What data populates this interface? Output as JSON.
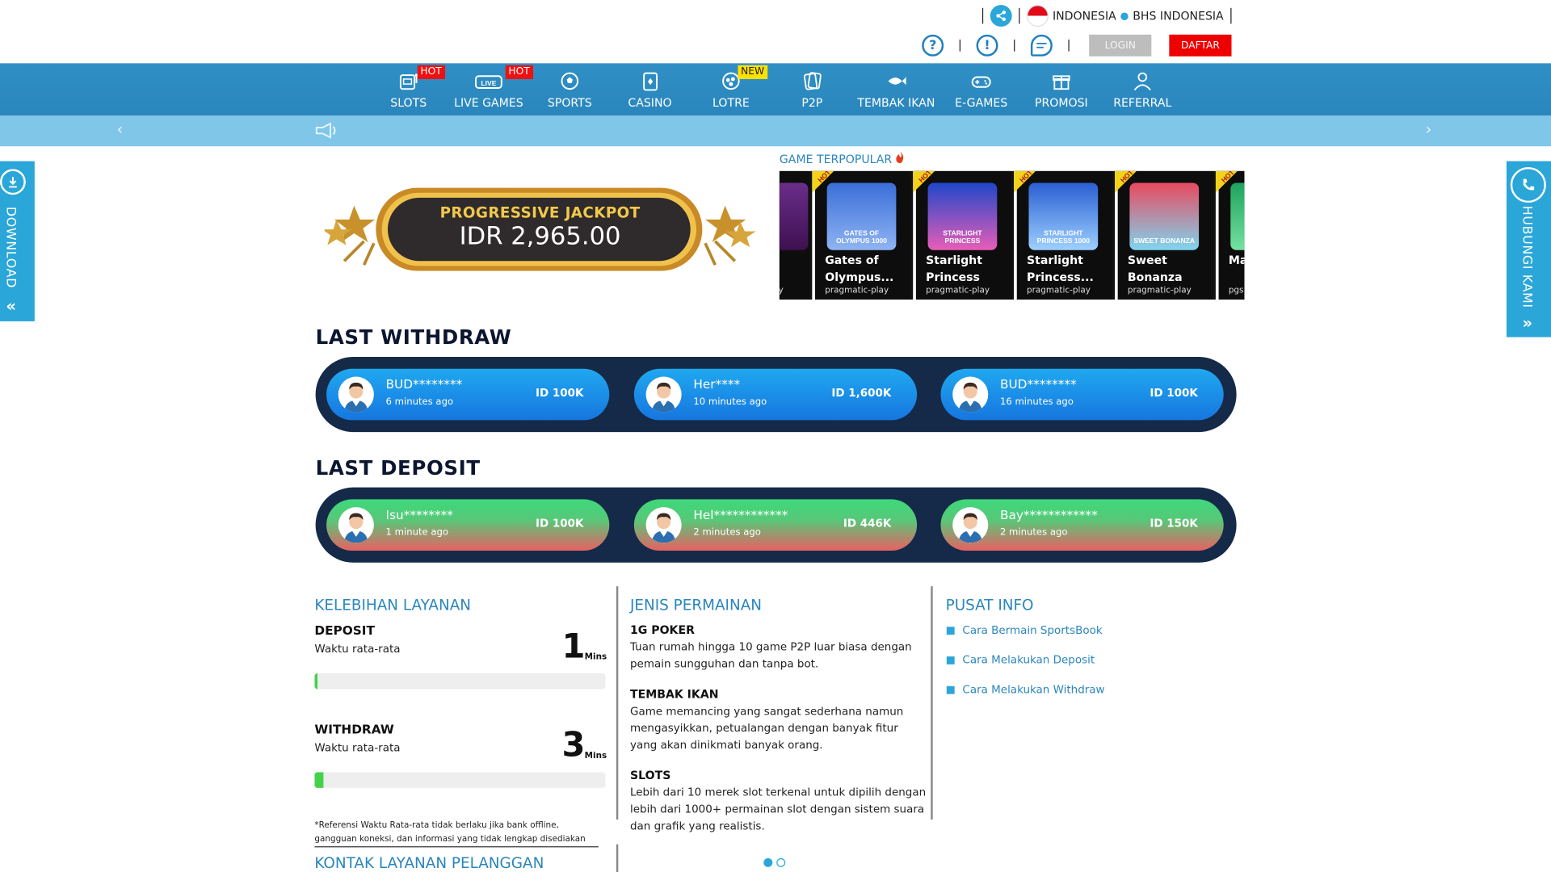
{
  "header": {
    "language_country": "INDONESIA",
    "language_name": "BHS INDONESIA",
    "login_label": "LOGIN",
    "register_label": "DAFTAR",
    "help_icon_glyph": "?",
    "info_icon_glyph": "!"
  },
  "nav": {
    "items": [
      {
        "label": "SLOTS",
        "badge": "HOT",
        "icon": "slot-machine-icon"
      },
      {
        "label": "LIVE GAMES",
        "badge": "HOT",
        "icon": "live-icon"
      },
      {
        "label": "SPORTS",
        "badge": "",
        "icon": "soccer-ball-icon"
      },
      {
        "label": "CASINO",
        "badge": "",
        "icon": "card-icon"
      },
      {
        "label": "LOTRE",
        "badge": "NEW",
        "icon": "lottery-icon"
      },
      {
        "label": "P2P",
        "badge": "",
        "icon": "p2p-cards-icon"
      },
      {
        "label": "TEMBAK IKAN",
        "badge": "",
        "icon": "fish-icon"
      },
      {
        "label": "E-GAMES",
        "badge": "",
        "icon": "gamepad-icon"
      },
      {
        "label": "PROMOSI",
        "badge": "",
        "icon": "gift-icon"
      },
      {
        "label": "REFERRAL",
        "badge": "",
        "icon": "referral-icon"
      }
    ]
  },
  "side": {
    "download_label": "DOWNLOAD",
    "contact_label": "HUBUNGI KAMI",
    "chevron_left": "«",
    "chevron_right": "»"
  },
  "jackpot": {
    "title": "PROGRESSIVE JACKPOT",
    "value": "IDR 2,965.00"
  },
  "popular": {
    "title": "GAME TERPOPULAR",
    "partial_prev_provider": "y",
    "games": [
      {
        "name": "Gates of Olympus...",
        "provider": "pragmatic-play",
        "thumb_text": "GATES OF OLYMPUS 1000",
        "colors": [
          "#3b6fd8",
          "#8fb4f4"
        ]
      },
      {
        "name": "Starlight Princess",
        "provider": "pragmatic-play",
        "thumb_text": "STARLIGHT PRINCESS",
        "colors": [
          "#1f47c9",
          "#e85db8"
        ]
      },
      {
        "name": "Starlight Princess...",
        "provider": "pragmatic-play",
        "thumb_text": "STARLIGHT PRINCESS 1000",
        "colors": [
          "#2a5fd3",
          "#9ed0ff"
        ]
      },
      {
        "name": "Sweet Bonanza",
        "provider": "pragmatic-play",
        "thumb_text": "SWEET BONANZA",
        "colors": [
          "#e84a5f",
          "#7fd5f0"
        ]
      },
      {
        "name": "Ma... Wi...",
        "provider": "pgs",
        "thumb_text": "",
        "colors": [
          "#1fa35c",
          "#74e2a0"
        ]
      }
    ],
    "hot_label": "HOT"
  },
  "last_withdraw": {
    "title": "LAST WITHDRAW",
    "items": [
      {
        "name": "BUD********",
        "time": "6 minutes ago",
        "amount": "ID 100K"
      },
      {
        "name": "Her****",
        "time": "10 minutes ago",
        "amount": "ID 1,600K"
      },
      {
        "name": "BUD********",
        "time": "16 minutes ago",
        "amount": "ID 100K"
      }
    ]
  },
  "last_deposit": {
    "title": "LAST DEPOSIT",
    "items": [
      {
        "name": "Isu********",
        "time": "1 minute ago",
        "amount": "ID 100K"
      },
      {
        "name": "Hel************",
        "time": "2 minutes ago",
        "amount": "ID 446K"
      },
      {
        "name": "Bay************",
        "time": "2 minutes ago",
        "amount": "ID 150K"
      }
    ]
  },
  "service": {
    "title": "KELEBIHAN LAYANAN",
    "deposit": {
      "label": "DEPOSIT",
      "sub": "Waktu rata-rata",
      "value": "1",
      "unit": "Mins",
      "progress": 0.01
    },
    "withdraw": {
      "label": "WITHDRAW",
      "sub": "Waktu rata-rata",
      "value": "3",
      "unit": "Mins",
      "progress": 0.03
    },
    "note": "*Referensi Waktu Rata-rata tidak berlaku jika bank offline, gangguan koneksi, dan informasi yang tidak lengkap disediakan",
    "contact_title": "KONTAK LAYANAN PELANGGAN"
  },
  "game_types": {
    "title": "JENIS PERMAINAN",
    "items": [
      {
        "heading": "1G POKER",
        "text": "Tuan rumah hingga 10 game P2P luar biasa dengan pemain sungguhan dan tanpa bot."
      },
      {
        "heading": "TEMBAK IKAN",
        "text": "Game memancing yang sangat sederhana namun mengasyikkan, petualangan dengan banyak fitur yang akan dinikmati banyak orang."
      },
      {
        "heading": "SLOTS",
        "text": "Lebih dari 10 merek slot terkenal untuk dipilih dengan lebih dari 1000+ permainan slot dengan sistem suara dan grafik yang realistis."
      }
    ]
  },
  "info_center": {
    "title": "PUSAT INFO",
    "links": [
      "Cara Bermain SportsBook",
      "Cara Melakukan Deposit",
      "Cara Melakukan Withdraw"
    ]
  },
  "colors": {
    "primary": "#2a86bd",
    "accent": "#2aa6d8",
    "danger": "#ee0000",
    "strip": "#152a48"
  }
}
